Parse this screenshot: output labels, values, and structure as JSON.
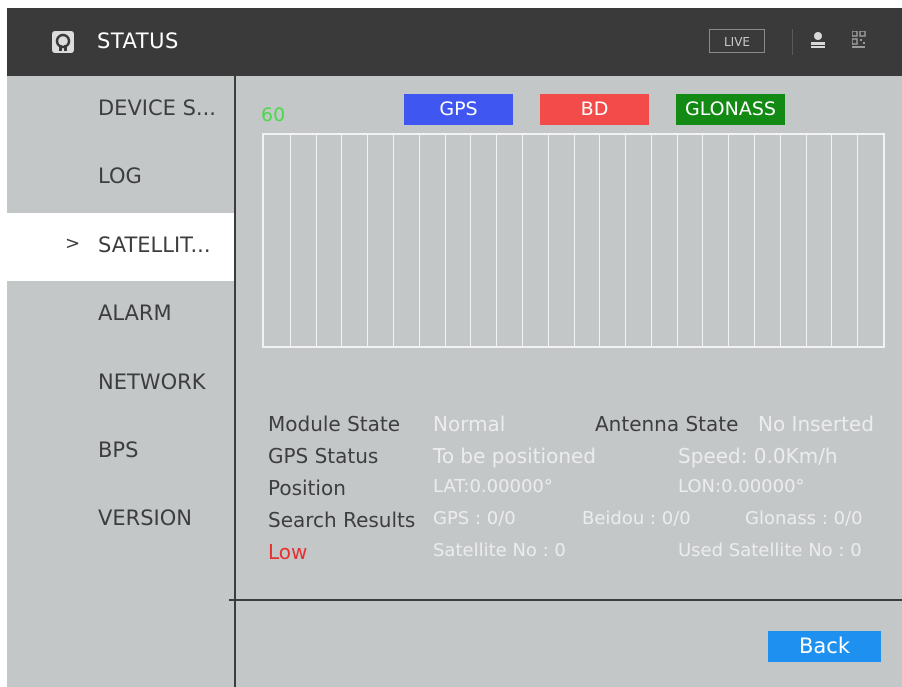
{
  "header": {
    "title": "STATUS",
    "live_label": "LIVE",
    "icons": [
      "app-logo-icon",
      "user-icon",
      "qr-icon"
    ]
  },
  "sidebar": {
    "items": [
      {
        "label": "DEVICE S..."
      },
      {
        "label": "LOG"
      },
      {
        "label": "SATELLIT...",
        "active": true,
        "chevron": ">"
      },
      {
        "label": "ALARM"
      },
      {
        "label": "NETWORK"
      },
      {
        "label": "BPS"
      },
      {
        "label": "VERSION"
      }
    ]
  },
  "signal_chart": {
    "scale_label": "60",
    "legend": [
      {
        "label": "GPS",
        "color": "#3f56f0"
      },
      {
        "label": "BD",
        "color": "#f34a4a"
      },
      {
        "label": "GLONASS",
        "color": "#138a14"
      }
    ]
  },
  "info": {
    "module_state_label": "Module State",
    "module_state_value": "Normal",
    "antenna_state_label": "Antenna State",
    "antenna_state_value": "No Inserted",
    "gps_status_label": "GPS Status",
    "gps_status_value": "To be positioned",
    "speed": "Speed: 0.0Km/h",
    "position_label": "Position",
    "lat": "LAT:0.00000°",
    "lon": "LON:0.00000°",
    "search_results_label": "Search Results",
    "gps_count": "GPS : 0/0",
    "beidou_count": "Beidou : 0/0",
    "glonass_count": "Glonass : 0/0",
    "signal_level": "Low",
    "satellite_no": "Satellite No : 0",
    "used_satellite_no": "Used Satellite No : 0"
  },
  "footer": {
    "back_label": "Back"
  }
}
